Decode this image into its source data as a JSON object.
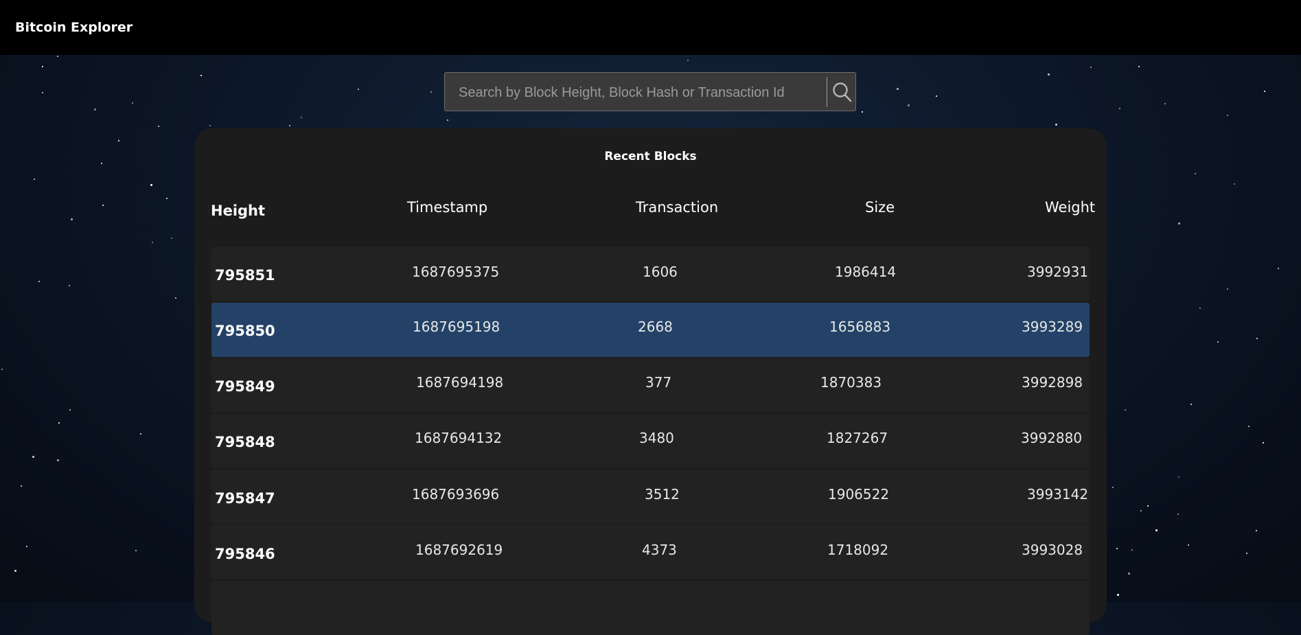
{
  "app": {
    "title": "Bitcoin Explorer"
  },
  "search": {
    "placeholder": "Search by Block Height, Block Hash or Transaction Id",
    "value": ""
  },
  "recent_blocks": {
    "title": "Recent Blocks",
    "columns": {
      "height": "Height",
      "timestamp": "Timestamp",
      "transaction": "Transaction",
      "size": "Size",
      "weight": "Weight"
    },
    "selected_height": "795850",
    "rows": [
      {
        "height": "795851",
        "timestamp": "1687695375",
        "transaction": "1606",
        "size": "1986414",
        "weight": "3992931"
      },
      {
        "height": "795850",
        "timestamp": "1687695198",
        "transaction": "2668",
        "size": "1656883",
        "weight": "3993289"
      },
      {
        "height": "795849",
        "timestamp": "1687694198",
        "transaction": "377",
        "size": "1870383",
        "weight": "3992898"
      },
      {
        "height": "795848",
        "timestamp": "1687694132",
        "transaction": "3480",
        "size": "1827267",
        "weight": "3992880"
      },
      {
        "height": "795847",
        "timestamp": "1687693696",
        "transaction": "3512",
        "size": "1906522",
        "weight": "3993142"
      },
      {
        "height": "795846",
        "timestamp": "1687692619",
        "transaction": "4373",
        "size": "1718092",
        "weight": "3993028"
      }
    ]
  },
  "colors": {
    "topbar": "#000000",
    "panel": "#1c1c1c",
    "row": "#222222",
    "row_selected": "#244267"
  },
  "icons": {
    "search_button": "search-icon"
  }
}
